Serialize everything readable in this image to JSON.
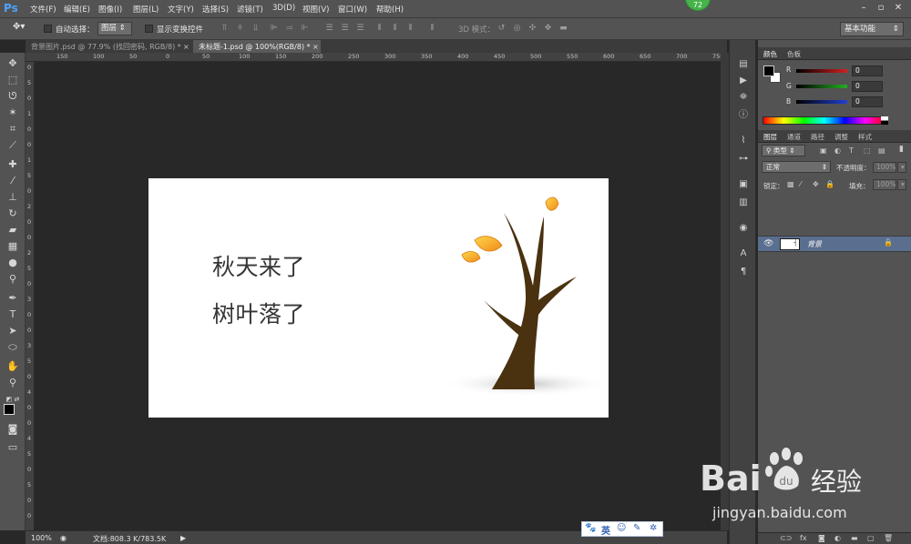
{
  "app": {
    "logo": "Ps",
    "notification_count": "72"
  },
  "menu": [
    {
      "label": "文件(F)",
      "key": "file"
    },
    {
      "label": "编辑(E)",
      "key": "edit"
    },
    {
      "label": "图像(I)",
      "key": "image"
    },
    {
      "label": "图层(L)",
      "key": "layer"
    },
    {
      "label": "文字(Y)",
      "key": "type"
    },
    {
      "label": "选择(S)",
      "key": "select"
    },
    {
      "label": "滤镜(T)",
      "key": "filter"
    },
    {
      "label": "3D(D)",
      "key": "3d"
    },
    {
      "label": "视图(V)",
      "key": "view"
    },
    {
      "label": "窗口(W)",
      "key": "window"
    },
    {
      "label": "帮助(H)",
      "key": "help"
    }
  ],
  "options": {
    "auto_select_label": "自动选择：",
    "auto_select_value": "图层",
    "show_transform_label": "显示变换控件",
    "mode_3d_label": "3D 模式：",
    "workspace": "基本功能"
  },
  "tabs": [
    {
      "label": "背景图片.psd @ 77.9% (找回密码, RGB/8) *",
      "active": false
    },
    {
      "label": "未标题-1.psd @ 100%(RGB/8) *",
      "active": true
    }
  ],
  "ruler": {
    "top": [
      "150",
      "100",
      "50",
      "0",
      "50",
      "100",
      "150",
      "200",
      "250",
      "300",
      "350",
      "400",
      "450",
      "500",
      "550",
      "600",
      "650",
      "700",
      "750"
    ],
    "left": [
      "0",
      "5",
      "0",
      "1",
      "0",
      "0",
      "1",
      "5",
      "0",
      "2",
      "0",
      "0",
      "2",
      "5",
      "0",
      "3",
      "0",
      "0",
      "3",
      "5",
      "0",
      "4",
      "0",
      "0",
      "4",
      "5",
      "0",
      "5",
      "0",
      "0"
    ]
  },
  "canvas": {
    "line1": "秋天来了",
    "line2": "树叶落了"
  },
  "status": {
    "zoom": "100%",
    "doc_size": "文档:808.3 K/783.5K"
  },
  "ime": {
    "mode": "英"
  },
  "color_panel": {
    "tabs": [
      "颜色",
      "色板"
    ],
    "channels": [
      {
        "label": "R",
        "value": "0",
        "color": "#d42020"
      },
      {
        "label": "G",
        "value": "0",
        "color": "#22b022"
      },
      {
        "label": "B",
        "value": "0",
        "color": "#2040d8"
      }
    ]
  },
  "layers_panel": {
    "tabs": [
      "图层",
      "通道",
      "路径",
      "调整",
      "样式"
    ],
    "filter_label": "类型",
    "blend_mode": "正常",
    "opacity_label": "不透明度：",
    "opacity_value": "100%",
    "lock_label": "锁定：",
    "fill_label": "填充：",
    "fill_value": "100%",
    "layer_name": "背景"
  },
  "watermark": {
    "brand": "Bai",
    "brand2": "经验",
    "url": "jingyan.baidu.com"
  }
}
